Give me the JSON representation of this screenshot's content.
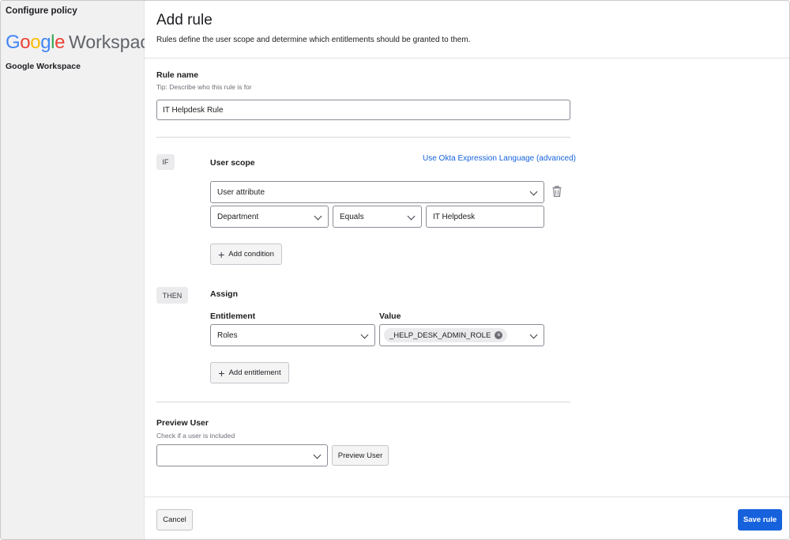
{
  "sidebar": {
    "title": "Configure policy",
    "logo_google": "Google",
    "logo_workspace": "Workspace",
    "app_name": "Google Workspace"
  },
  "header": {
    "title": "Add rule",
    "description": "Rules define the user scope and determine which entitlements should be granted to them."
  },
  "rule_name": {
    "label": "Rule name",
    "tip": "Tip: Describe who this rule is for",
    "value": "IT Helpdesk Rule"
  },
  "if_block": {
    "tag": "IF",
    "heading": "User scope",
    "expression_link": "Use Okta Expression Language (advanced)",
    "scope_select": "User attribute",
    "attribute_select": "Department",
    "operator_select": "Equals",
    "value": "IT Helpdesk",
    "add_condition_label": "Add condition"
  },
  "then_block": {
    "tag": "THEN",
    "heading": "Assign",
    "entitlement_label": "Entitlement",
    "value_label": "Value",
    "entitlement_select": "Roles",
    "value_chip": "_HELP_DESK_ADMIN_ROLE",
    "add_entitlement_label": "Add entitlement"
  },
  "preview": {
    "label": "Preview User",
    "tip": "Check if a user is included",
    "select_value": "",
    "button_label": "Preview User"
  },
  "footer": {
    "cancel_label": "Cancel",
    "save_label": "Save rule"
  },
  "colors": {
    "accent": "#1662dd",
    "sidebar_bg": "#f1f1f2",
    "google_blue": "#4285F4",
    "google_red": "#EA4335",
    "google_yellow": "#FBBC05",
    "google_green": "#34A853"
  },
  "icons": {
    "delete": "trash-icon",
    "add": "plus-icon",
    "dropdown": "chevron-down-icon",
    "remove_chip": "close-circle-icon"
  }
}
